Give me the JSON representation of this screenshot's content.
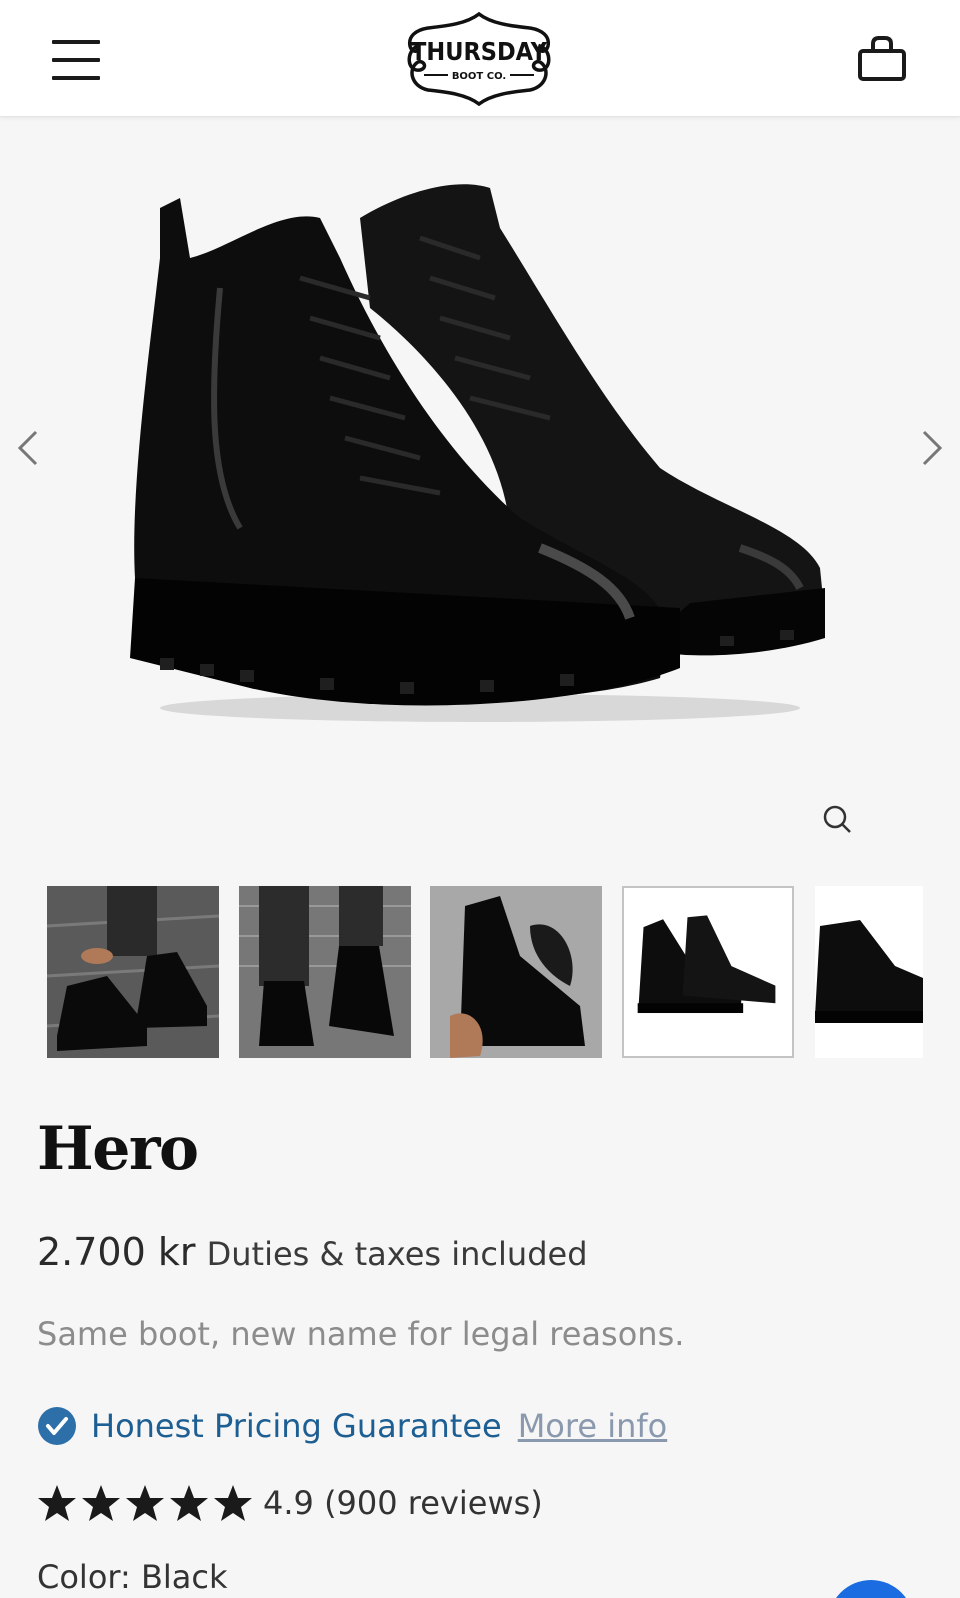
{
  "header": {
    "menu_icon": "hamburger-menu-icon",
    "logo_name": "THURSDAY",
    "logo_sub": "BOOT CO.",
    "cart_icon": "shopping-bag-icon"
  },
  "gallery": {
    "prev_icon": "chevron-left-icon",
    "next_icon": "chevron-right-icon",
    "zoom_icon": "magnifier-icon",
    "thumbnail_count": 5,
    "selected_thumbnail": 4
  },
  "product": {
    "title": "Hero",
    "price": "2.700 kr",
    "tax_note": "Duties & taxes included",
    "subtitle": "Same boot, new name for legal reasons.",
    "guarantee_label": "Honest Pricing Guarantee",
    "more_info_label": "More info",
    "rating_value": "4.9",
    "rating_text": "4.9 (900 reviews)",
    "stars": 5,
    "color_label": "Color: Black"
  },
  "colors": {
    "accent_blue": "#1d5e93",
    "check_blue": "#2d6fa8",
    "chat_blue": "#1a6ce0"
  }
}
